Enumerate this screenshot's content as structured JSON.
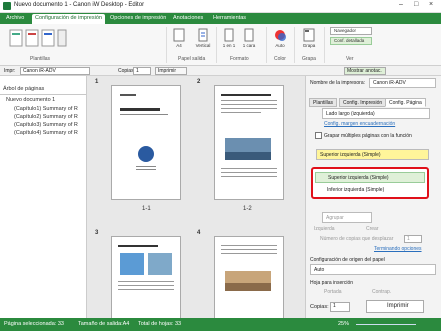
{
  "window": {
    "title": "Nuevo documento 1 - Canon iW Desktop - Editor"
  },
  "ribbon_tabs": [
    "Archivo",
    "Configuración de impresión",
    "Opciones de impresión",
    "Anotaciones",
    "Herramientas"
  ],
  "ribbon": {
    "groups": [
      "Plantillas",
      "Papel salida",
      "Formato",
      "Color",
      "Grapa",
      "Ver"
    ],
    "buttons": {
      "paper": "A4",
      "orientation": "Vertical",
      "layout": "1 en 1",
      "sides": "1 cara",
      "color": "Auto",
      "staple": "Grapa",
      "navigator": "Navegador",
      "detail": "Conf. detallada"
    }
  },
  "toolbar": {
    "printer_label": "Impr:",
    "printer_value": "Canon iR-ADV",
    "copies_label": "Copias:",
    "copies_value": "1",
    "print_label": "Imprimir",
    "zoom_out": "Mostrar anotac."
  },
  "left_panel": {
    "header": "Árbol de páginas",
    "root": "Nuevo documento 1",
    "items": [
      "(Capítulo1) Summary of R",
      "(Capítulo2) Summary of R",
      "(Capítulo3) Summary of R",
      "(Capítulo4) Summary of R"
    ]
  },
  "pages": [
    {
      "number": "1",
      "label": "1-1"
    },
    {
      "number": "2",
      "label": "1-2"
    },
    {
      "number": "3",
      "label": ""
    },
    {
      "number": "4",
      "label": ""
    }
  ],
  "right_panel": {
    "printer_label": "Nombre de la impresora:",
    "printer_value": "Canon iR-ADV",
    "tabs": [
      "Plantillas",
      "Config. Impresión",
      "Config. Página"
    ],
    "long_edge": "Lado largo (izquierda)",
    "config_link": "Config. margen encuadernación",
    "staple_label": "Grapar múltiples páginas con la función",
    "staple_selected": "Superior izquierda (Simple)",
    "options": [
      "Superior izquierda (Simple)",
      "Inferior izquierda (Simple)"
    ],
    "group_label": "Agrupar",
    "check1": "Izquierda",
    "check2": "Crear",
    "copies_label": "Número de copias que desplazar",
    "copies_value": "1",
    "finish_link": "Terminando opciones",
    "source_label": "Configuración de origen del papel",
    "source_value": "Auto",
    "insert_label": "Hoja para inserción",
    "front": "Portada",
    "back": "Contrap.",
    "copies2_label": "Copias:",
    "copies2_value": "1",
    "print_button": "Imprimir"
  },
  "status": {
    "selected": "Página seleccionada: 33",
    "size": "Tamaño de salida:A4",
    "total": "Total de hojas: 33",
    "zoom": "25%"
  }
}
